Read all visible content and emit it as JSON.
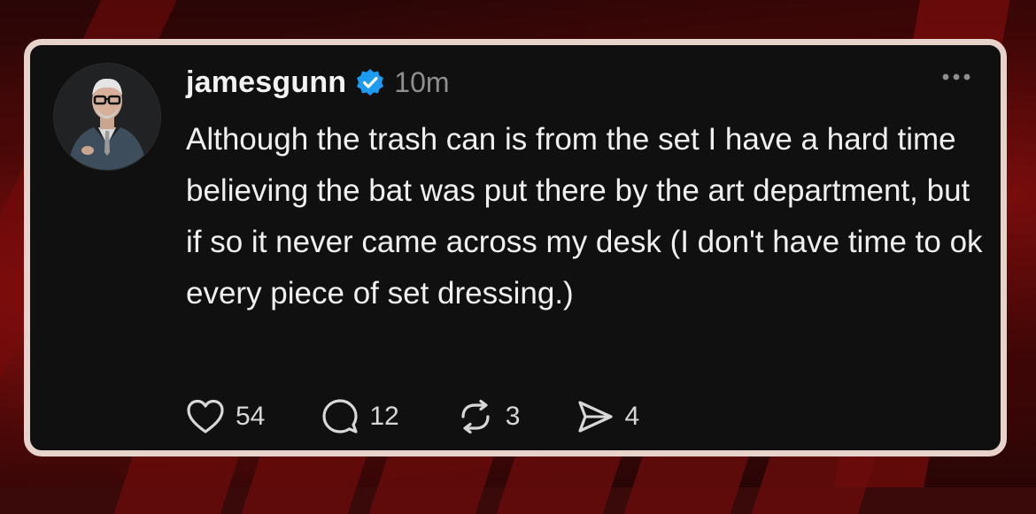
{
  "post": {
    "username": "jamesgunn",
    "time": "10m",
    "text": "Although the trash can is from the set I have a hard time believing the bat was put there by the art department, but if so it never came across my desk (I don't have time to ok every piece of set dressing.)",
    "verified_icon": "verified-badge-icon",
    "more_icon": "more-options-icon"
  },
  "actions": {
    "likes": "54",
    "replies": "12",
    "reposts": "3",
    "shares": "4",
    "like_icon": "heart-icon",
    "reply_icon": "comment-icon",
    "repost_icon": "repost-icon",
    "share_icon": "send-icon"
  },
  "colors": {
    "card_background": "#101010",
    "card_border": "#e8d3cc",
    "verified": "#1d9bf0",
    "page_background": "#3a0a0a"
  }
}
